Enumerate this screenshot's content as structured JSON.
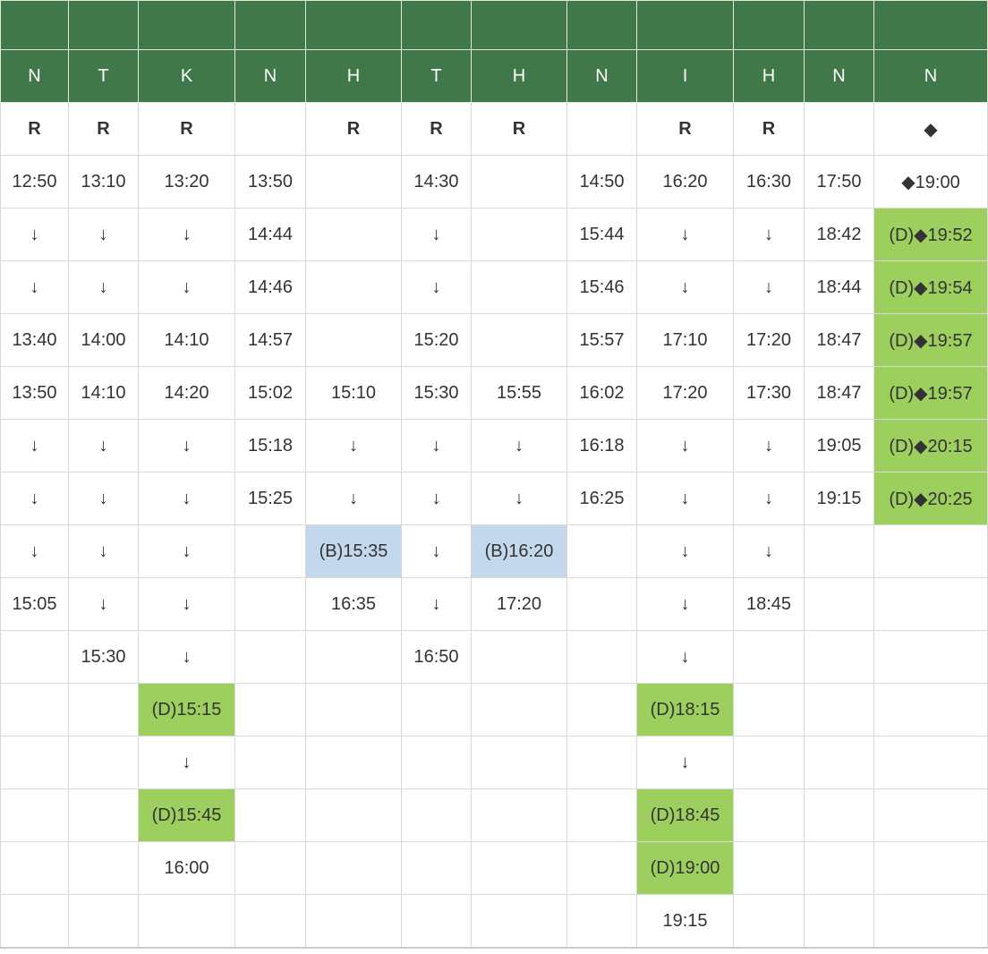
{
  "columns": [
    "N",
    "T",
    "K",
    "N",
    "H",
    "T",
    "H",
    "N",
    "I",
    "H",
    "N",
    "N"
  ],
  "rows": [
    [
      {
        "t": "R",
        "c": "red"
      },
      {
        "t": "R",
        "c": "red"
      },
      {
        "t": "R",
        "c": "red"
      },
      {
        "t": "",
        "c": ""
      },
      {
        "t": "R",
        "c": "red"
      },
      {
        "t": "R",
        "c": "red"
      },
      {
        "t": "R",
        "c": "red"
      },
      {
        "t": "",
        "c": ""
      },
      {
        "t": "R",
        "c": "red"
      },
      {
        "t": "R",
        "c": "red"
      },
      {
        "t": "",
        "c": ""
      },
      {
        "t": "◆",
        "c": "red"
      }
    ],
    [
      {
        "t": "12:50",
        "c": ""
      },
      {
        "t": "13:10",
        "c": ""
      },
      {
        "t": "13:20",
        "c": ""
      },
      {
        "t": "13:50",
        "c": ""
      },
      {
        "t": "",
        "c": ""
      },
      {
        "t": "14:30",
        "c": ""
      },
      {
        "t": "",
        "c": ""
      },
      {
        "t": "14:50",
        "c": ""
      },
      {
        "t": "16:20",
        "c": ""
      },
      {
        "t": "16:30",
        "c": ""
      },
      {
        "t": "17:50",
        "c": ""
      },
      {
        "t": "◆19:00",
        "c": "redtxt"
      }
    ],
    [
      {
        "t": "↓",
        "c": ""
      },
      {
        "t": "↓",
        "c": ""
      },
      {
        "t": "↓",
        "c": ""
      },
      {
        "t": "14:44",
        "c": ""
      },
      {
        "t": "",
        "c": ""
      },
      {
        "t": "↓",
        "c": ""
      },
      {
        "t": "",
        "c": ""
      },
      {
        "t": "15:44",
        "c": ""
      },
      {
        "t": "↓",
        "c": ""
      },
      {
        "t": "↓",
        "c": ""
      },
      {
        "t": "18:42",
        "c": ""
      },
      {
        "t": "(D)◆19:52",
        "c": "green redtxt"
      }
    ],
    [
      {
        "t": "↓",
        "c": ""
      },
      {
        "t": "↓",
        "c": ""
      },
      {
        "t": "↓",
        "c": ""
      },
      {
        "t": "14:46",
        "c": ""
      },
      {
        "t": "",
        "c": ""
      },
      {
        "t": "↓",
        "c": ""
      },
      {
        "t": "",
        "c": ""
      },
      {
        "t": "15:46",
        "c": ""
      },
      {
        "t": "↓",
        "c": ""
      },
      {
        "t": "↓",
        "c": ""
      },
      {
        "t": "18:44",
        "c": ""
      },
      {
        "t": "(D)◆19:54",
        "c": "green redtxt"
      }
    ],
    [
      {
        "t": "13:40",
        "c": ""
      },
      {
        "t": "14:00",
        "c": ""
      },
      {
        "t": "14:10",
        "c": ""
      },
      {
        "t": "14:57",
        "c": ""
      },
      {
        "t": "",
        "c": ""
      },
      {
        "t": "15:20",
        "c": ""
      },
      {
        "t": "",
        "c": ""
      },
      {
        "t": "15:57",
        "c": ""
      },
      {
        "t": "17:10",
        "c": ""
      },
      {
        "t": "17:20",
        "c": ""
      },
      {
        "t": "18:47",
        "c": ""
      },
      {
        "t": "(D)◆19:57",
        "c": "green redtxt"
      }
    ],
    [
      {
        "t": "13:50",
        "c": ""
      },
      {
        "t": "14:10",
        "c": ""
      },
      {
        "t": "14:20",
        "c": ""
      },
      {
        "t": "15:02",
        "c": ""
      },
      {
        "t": "15:10",
        "c": ""
      },
      {
        "t": "15:30",
        "c": ""
      },
      {
        "t": "15:55",
        "c": ""
      },
      {
        "t": "16:02",
        "c": ""
      },
      {
        "t": "17:20",
        "c": ""
      },
      {
        "t": "17:30",
        "c": ""
      },
      {
        "t": "18:47",
        "c": ""
      },
      {
        "t": "(D)◆19:57",
        "c": "green redtxt"
      }
    ],
    [
      {
        "t": "↓",
        "c": ""
      },
      {
        "t": "↓",
        "c": ""
      },
      {
        "t": "↓",
        "c": ""
      },
      {
        "t": "15:18",
        "c": ""
      },
      {
        "t": "↓",
        "c": ""
      },
      {
        "t": "↓",
        "c": ""
      },
      {
        "t": "↓",
        "c": ""
      },
      {
        "t": "16:18",
        "c": ""
      },
      {
        "t": "↓",
        "c": ""
      },
      {
        "t": "↓",
        "c": ""
      },
      {
        "t": "19:05",
        "c": ""
      },
      {
        "t": "(D)◆20:15",
        "c": "green redtxt"
      }
    ],
    [
      {
        "t": "↓",
        "c": ""
      },
      {
        "t": "↓",
        "c": ""
      },
      {
        "t": "↓",
        "c": ""
      },
      {
        "t": "15:25",
        "c": ""
      },
      {
        "t": "↓",
        "c": ""
      },
      {
        "t": "↓",
        "c": ""
      },
      {
        "t": "↓",
        "c": ""
      },
      {
        "t": "16:25",
        "c": ""
      },
      {
        "t": "↓",
        "c": ""
      },
      {
        "t": "↓",
        "c": ""
      },
      {
        "t": "19:15",
        "c": ""
      },
      {
        "t": "(D)◆20:25",
        "c": "green redtxt"
      }
    ],
    [
      {
        "t": "↓",
        "c": ""
      },
      {
        "t": "↓",
        "c": ""
      },
      {
        "t": "↓",
        "c": ""
      },
      {
        "t": "",
        "c": ""
      },
      {
        "t": "(B)15:35",
        "c": "blue"
      },
      {
        "t": "↓",
        "c": ""
      },
      {
        "t": "(B)16:20",
        "c": "blue"
      },
      {
        "t": "",
        "c": ""
      },
      {
        "t": "↓",
        "c": ""
      },
      {
        "t": "↓",
        "c": ""
      },
      {
        "t": "",
        "c": ""
      },
      {
        "t": "",
        "c": ""
      }
    ],
    [
      {
        "t": "15:05",
        "c": ""
      },
      {
        "t": "↓",
        "c": ""
      },
      {
        "t": "↓",
        "c": ""
      },
      {
        "t": "",
        "c": ""
      },
      {
        "t": "16:35",
        "c": ""
      },
      {
        "t": "↓",
        "c": ""
      },
      {
        "t": "17:20",
        "c": ""
      },
      {
        "t": "",
        "c": ""
      },
      {
        "t": "↓",
        "c": ""
      },
      {
        "t": "18:45",
        "c": ""
      },
      {
        "t": "",
        "c": ""
      },
      {
        "t": "",
        "c": ""
      }
    ],
    [
      {
        "t": "",
        "c": ""
      },
      {
        "t": "15:30",
        "c": ""
      },
      {
        "t": "↓",
        "c": ""
      },
      {
        "t": "",
        "c": ""
      },
      {
        "t": "",
        "c": ""
      },
      {
        "t": "16:50",
        "c": ""
      },
      {
        "t": "",
        "c": ""
      },
      {
        "t": "",
        "c": ""
      },
      {
        "t": "↓",
        "c": ""
      },
      {
        "t": "",
        "c": ""
      },
      {
        "t": "",
        "c": ""
      },
      {
        "t": "",
        "c": ""
      }
    ],
    [
      {
        "t": "",
        "c": ""
      },
      {
        "t": "",
        "c": ""
      },
      {
        "t": "(D)15:15",
        "c": "green"
      },
      {
        "t": "",
        "c": ""
      },
      {
        "t": "",
        "c": ""
      },
      {
        "t": "",
        "c": ""
      },
      {
        "t": "",
        "c": ""
      },
      {
        "t": "",
        "c": ""
      },
      {
        "t": "(D)18:15",
        "c": "green"
      },
      {
        "t": "",
        "c": ""
      },
      {
        "t": "",
        "c": ""
      },
      {
        "t": "",
        "c": ""
      }
    ],
    [
      {
        "t": "",
        "c": ""
      },
      {
        "t": "",
        "c": ""
      },
      {
        "t": "↓",
        "c": ""
      },
      {
        "t": "",
        "c": ""
      },
      {
        "t": "",
        "c": ""
      },
      {
        "t": "",
        "c": ""
      },
      {
        "t": "",
        "c": ""
      },
      {
        "t": "",
        "c": ""
      },
      {
        "t": "↓",
        "c": ""
      },
      {
        "t": "",
        "c": ""
      },
      {
        "t": "",
        "c": ""
      },
      {
        "t": "",
        "c": ""
      }
    ],
    [
      {
        "t": "",
        "c": ""
      },
      {
        "t": "",
        "c": ""
      },
      {
        "t": "(D)15:45",
        "c": "green"
      },
      {
        "t": "",
        "c": ""
      },
      {
        "t": "",
        "c": ""
      },
      {
        "t": "",
        "c": ""
      },
      {
        "t": "",
        "c": ""
      },
      {
        "t": "",
        "c": ""
      },
      {
        "t": "(D)18:45",
        "c": "green"
      },
      {
        "t": "",
        "c": ""
      },
      {
        "t": "",
        "c": ""
      },
      {
        "t": "",
        "c": ""
      }
    ],
    [
      {
        "t": "",
        "c": ""
      },
      {
        "t": "",
        "c": ""
      },
      {
        "t": "16:00",
        "c": ""
      },
      {
        "t": "",
        "c": ""
      },
      {
        "t": "",
        "c": ""
      },
      {
        "t": "",
        "c": ""
      },
      {
        "t": "",
        "c": ""
      },
      {
        "t": "",
        "c": ""
      },
      {
        "t": "(D)19:00",
        "c": "green"
      },
      {
        "t": "",
        "c": ""
      },
      {
        "t": "",
        "c": ""
      },
      {
        "t": "",
        "c": ""
      }
    ],
    [
      {
        "t": "",
        "c": ""
      },
      {
        "t": "",
        "c": ""
      },
      {
        "t": "",
        "c": ""
      },
      {
        "t": "",
        "c": ""
      },
      {
        "t": "",
        "c": ""
      },
      {
        "t": "",
        "c": ""
      },
      {
        "t": "",
        "c": ""
      },
      {
        "t": "",
        "c": ""
      },
      {
        "t": "19:15",
        "c": ""
      },
      {
        "t": "",
        "c": ""
      },
      {
        "t": "",
        "c": ""
      },
      {
        "t": "",
        "c": ""
      }
    ]
  ],
  "colors": {
    "header_bg": "#41784a",
    "header_text": "#ffffff",
    "reserved_red": "#e8372a",
    "highlight_green": "#9dcf5f",
    "highlight_blue": "#c3d8ec",
    "grid_line": "#d9d9d9"
  }
}
